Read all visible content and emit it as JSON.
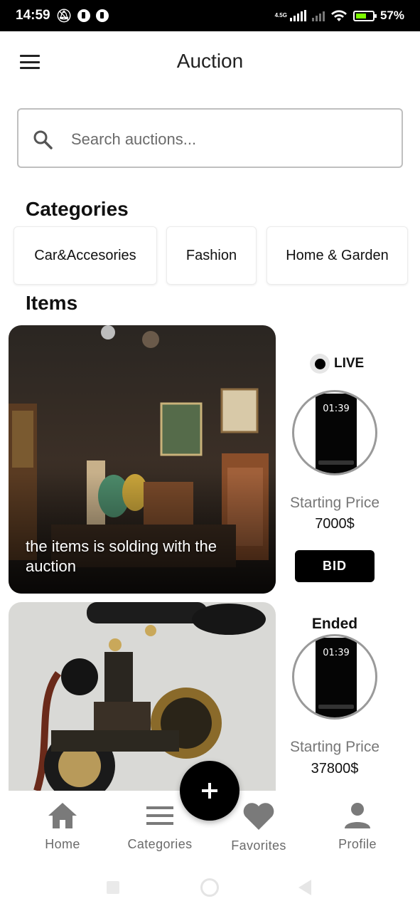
{
  "status_bar": {
    "time": "14:59",
    "network": "4.5G",
    "battery": "57%"
  },
  "header": {
    "title": "Auction"
  },
  "search": {
    "placeholder": "Search auctions..."
  },
  "categories": {
    "heading": "Categories",
    "items": [
      {
        "label": "Car&Accesories"
      },
      {
        "label": "Fashion"
      },
      {
        "label": "Home & Garden"
      }
    ]
  },
  "items": {
    "heading": "Items",
    "list": [
      {
        "caption": "the items is solding with the auction",
        "status": "LIVE",
        "timer": "01:39",
        "price_label": "Starting Price",
        "price": "7000$",
        "action_label": "BID"
      },
      {
        "caption": "",
        "status": "Ended",
        "timer": "01:39",
        "price_label": "Starting Price",
        "price": "37800$"
      }
    ]
  },
  "bottom_nav": {
    "fab_icon": "plus-icon",
    "items": [
      {
        "label": "Home",
        "icon": "home-icon"
      },
      {
        "label": "Categories",
        "icon": "list-icon"
      },
      {
        "label": "Favorites",
        "icon": "heart-icon"
      },
      {
        "label": "Profile",
        "icon": "user-icon"
      }
    ]
  },
  "colors": {
    "accent": "#000000",
    "nav_icon": "#7a7a7a",
    "muted_text": "#777777"
  }
}
